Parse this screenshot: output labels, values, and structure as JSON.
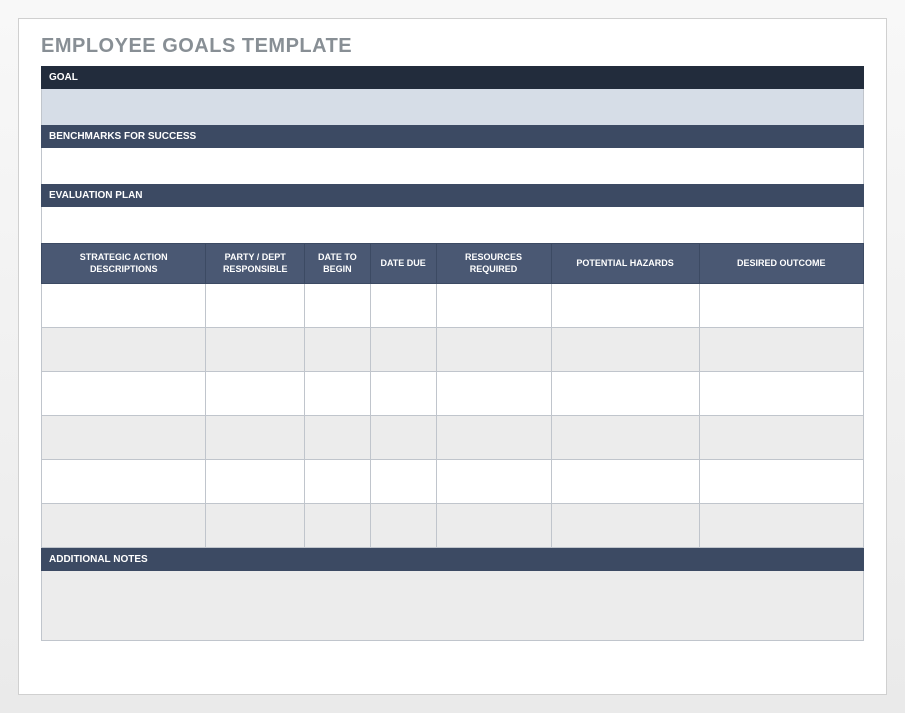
{
  "title": "EMPLOYEE GOALS TEMPLATE",
  "sections": {
    "goal": {
      "label": "GOAL",
      "value": ""
    },
    "benchmarks": {
      "label": "BENCHMARKS FOR SUCCESS",
      "value": ""
    },
    "evaluation": {
      "label": "EVALUATION PLAN",
      "value": ""
    },
    "notes": {
      "label": "ADDITIONAL NOTES",
      "value": ""
    }
  },
  "table": {
    "headers": [
      "STRATEGIC ACTION DESCRIPTIONS",
      "PARTY / DEPT RESPONSIBLE",
      "DATE TO BEGIN",
      "DATE DUE",
      "RESOURCES REQUIRED",
      "POTENTIAL HAZARDS",
      "DESIRED OUTCOME"
    ],
    "col_widths_pct": [
      20,
      12,
      8,
      8,
      14,
      18,
      20
    ],
    "rows": [
      [
        "",
        "",
        "",
        "",
        "",
        "",
        ""
      ],
      [
        "",
        "",
        "",
        "",
        "",
        "",
        ""
      ],
      [
        "",
        "",
        "",
        "",
        "",
        "",
        ""
      ],
      [
        "",
        "",
        "",
        "",
        "",
        "",
        ""
      ],
      [
        "",
        "",
        "",
        "",
        "",
        "",
        ""
      ],
      [
        "",
        "",
        "",
        "",
        "",
        "",
        ""
      ]
    ]
  }
}
